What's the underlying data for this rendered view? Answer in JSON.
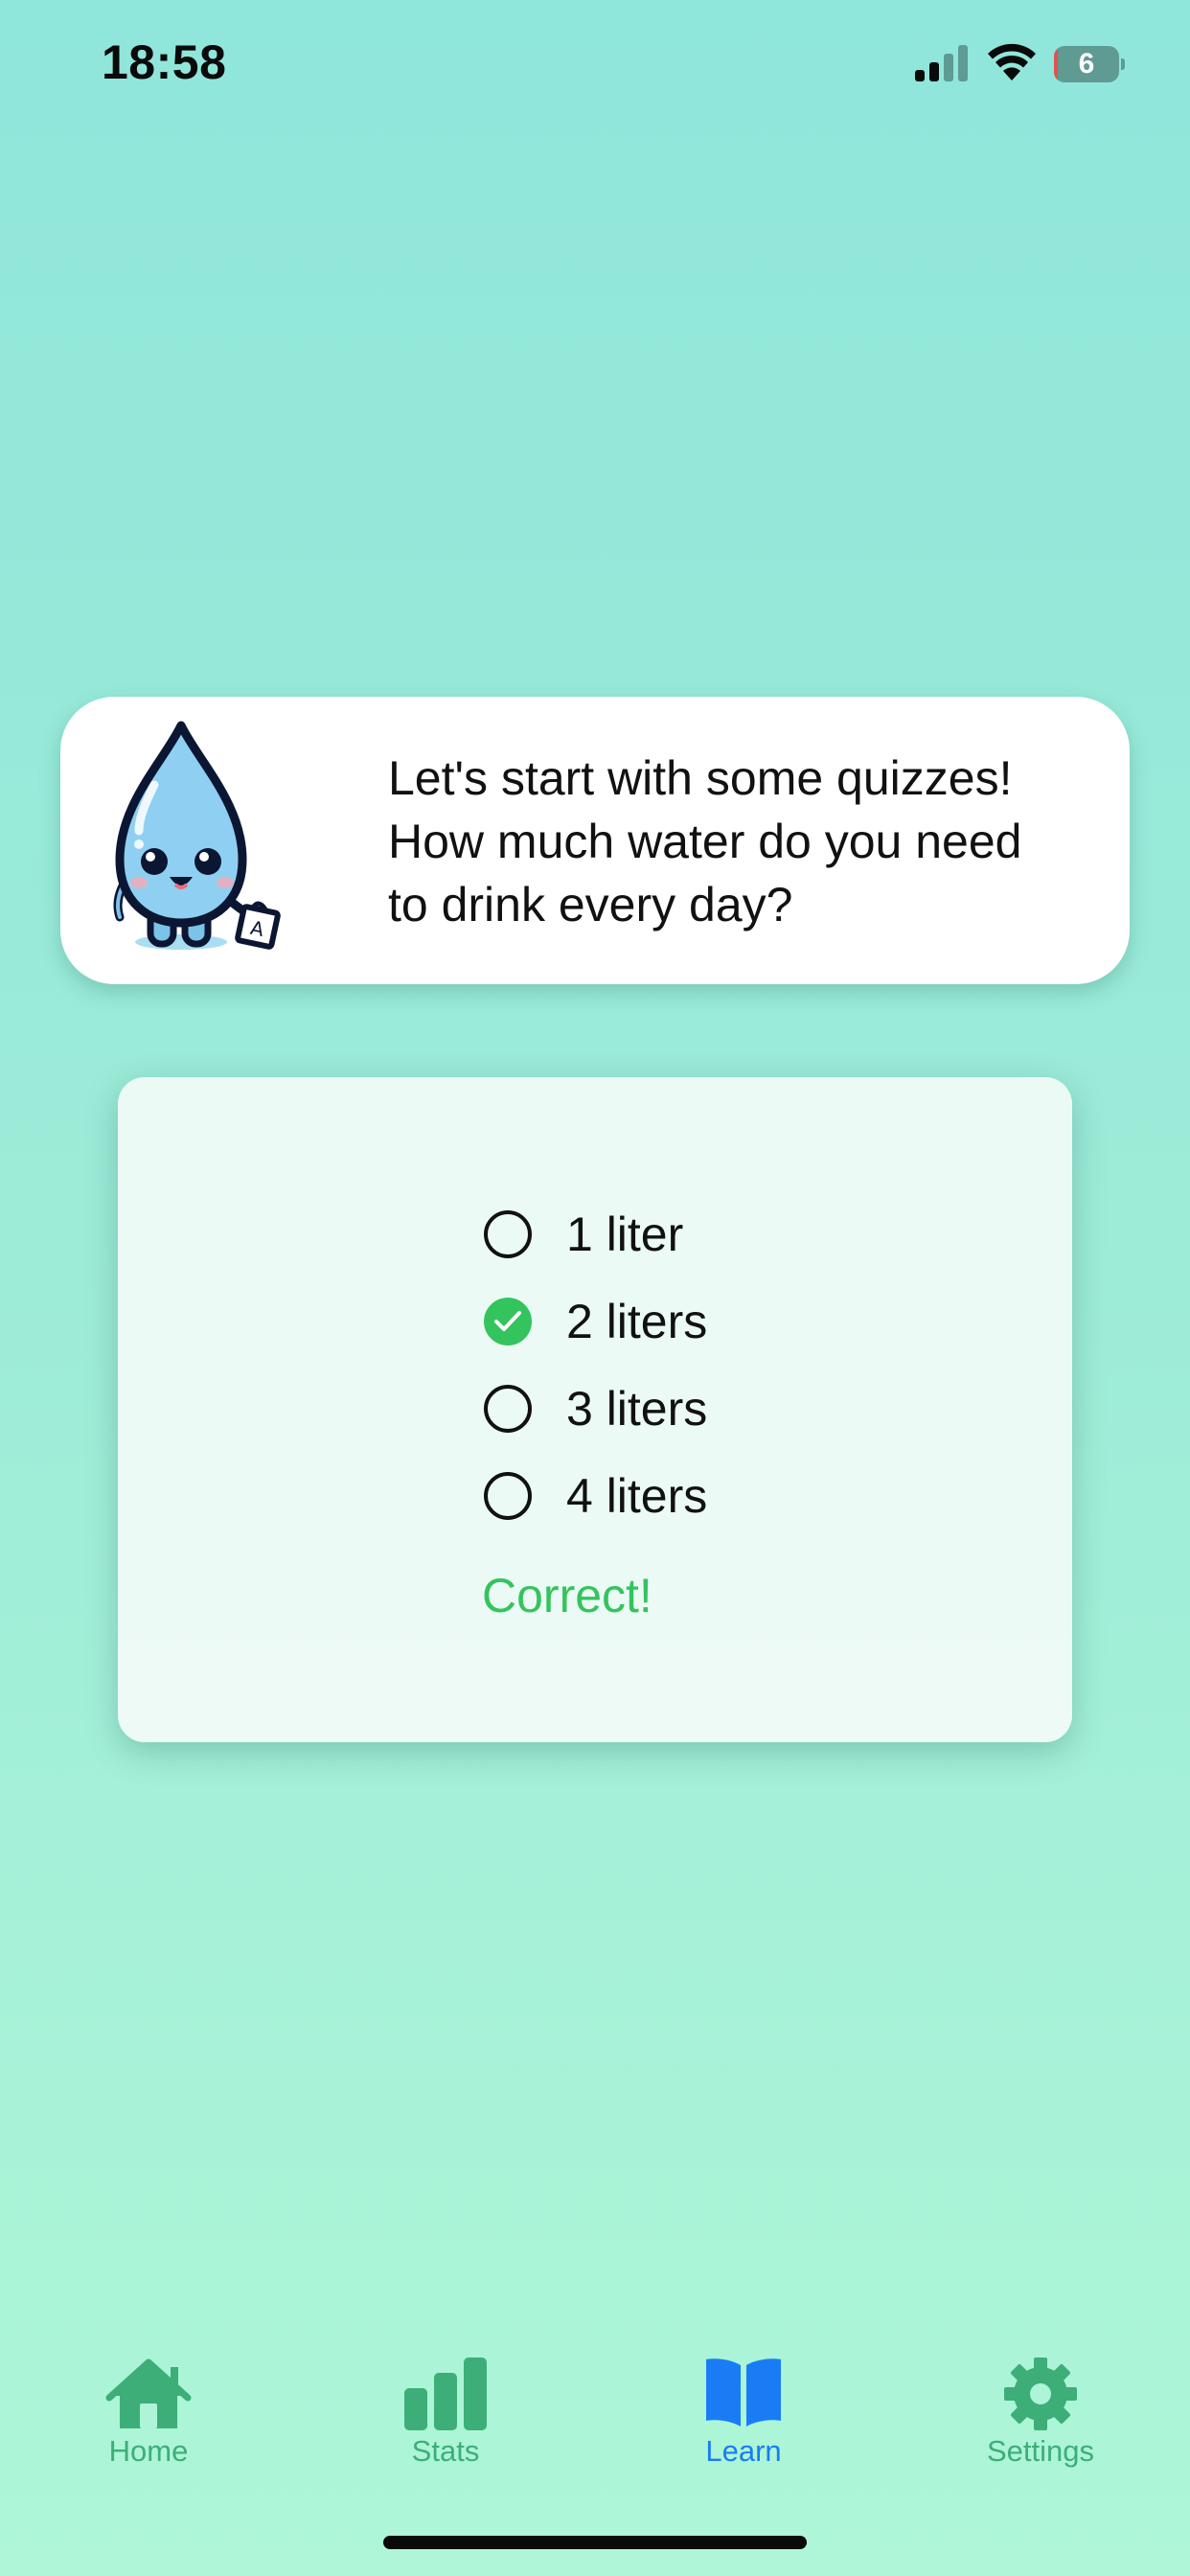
{
  "status_bar": {
    "time": "18:58",
    "battery_level": "6",
    "battery_fraction": 0.06,
    "icons": [
      "signal-icon",
      "wifi-icon",
      "battery-icon"
    ]
  },
  "message": {
    "mascot_icon": "water-drop-mascot-icon",
    "lines": [
      "Let's start with some quizzes!",
      "How much water do you need",
      "to drink every day?"
    ]
  },
  "quiz": {
    "options": [
      {
        "label": "1 liter",
        "selected": false
      },
      {
        "label": "2 liters",
        "selected": true
      },
      {
        "label": "3 liters",
        "selected": false
      },
      {
        "label": "4 liters",
        "selected": false
      }
    ],
    "feedback": "Correct!",
    "feedback_color": "#34c45d"
  },
  "tab_bar": {
    "active_color": "#1a7cf5",
    "inactive_color": "#3dae78",
    "tabs": [
      {
        "label": "Home",
        "icon": "house-icon",
        "active": false
      },
      {
        "label": "Stats",
        "icon": "bar-chart-icon",
        "active": false
      },
      {
        "label": "Learn",
        "icon": "open-book-icon",
        "active": true
      },
      {
        "label": "Settings",
        "icon": "gear-icon",
        "active": false
      }
    ]
  }
}
